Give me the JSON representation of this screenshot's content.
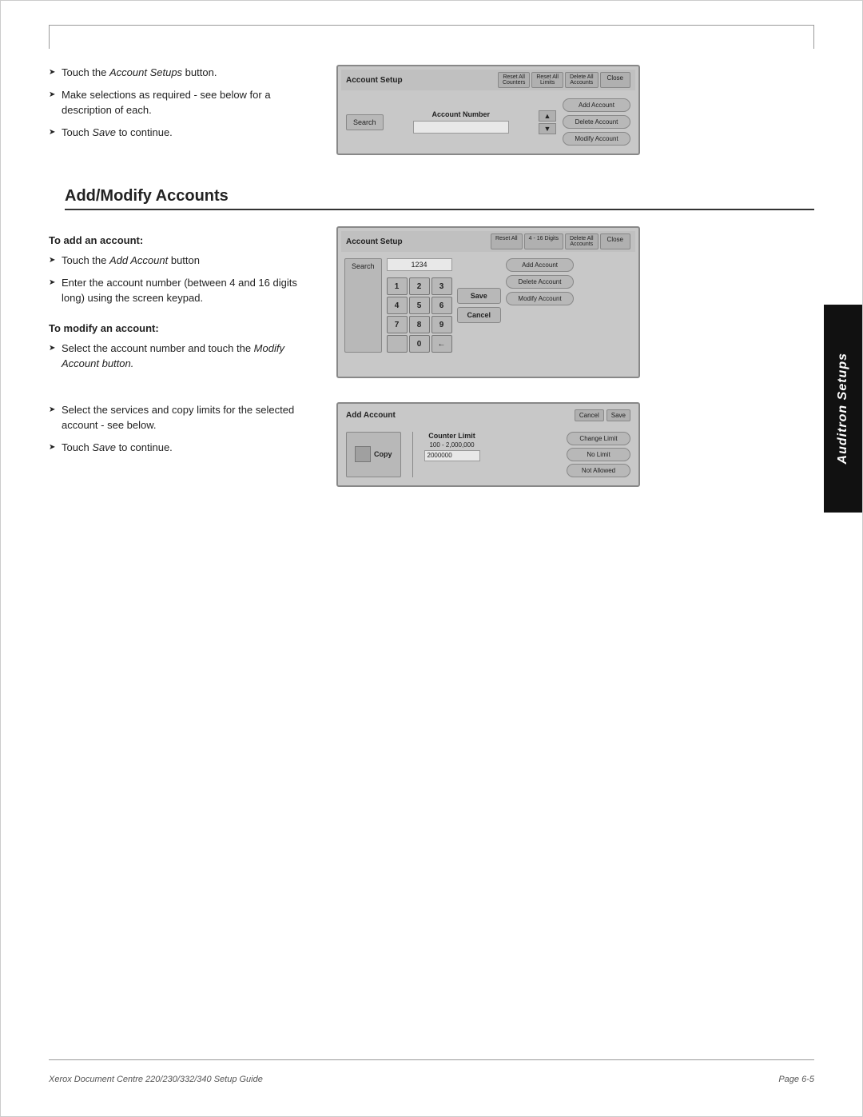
{
  "page": {
    "title": "Auditron Setups",
    "footer_left": "Xerox Document Centre 220/230/332/340 Setup Guide",
    "footer_right": "Page 6-5"
  },
  "section1": {
    "bullets": [
      "Touch the Account Setups button.",
      "Make selections as required - see below for a description of each.",
      "Touch Save to continue."
    ],
    "bullet_italic_parts": [
      "Account Setups",
      "Save"
    ]
  },
  "account_setup_ui1": {
    "title": "Account Setup",
    "btn_reset_all_counters": "Reset All Counters",
    "btn_reset_all_limits": "Reset All Limits",
    "btn_delete_all_accounts": "Delete All Accounts",
    "btn_close": "Close",
    "btn_search": "Search",
    "label_account_number": "Account Number",
    "btn_add_account": "Add Account",
    "btn_delete_account": "Delete Account",
    "btn_modify_account": "Modify Account"
  },
  "section_heading": "Add/Modify Accounts",
  "add_account_section": {
    "title": "To add an account:",
    "bullets": [
      "Touch the Add Account button",
      "Enter the account number (between 4 and 16 digits long) using the screen keypad.",
      ""
    ],
    "bullet_italic": [
      "Add Account",
      "Modify Account button."
    ]
  },
  "modify_section": {
    "title": "To modify an account:",
    "bullets": [
      "Select the account number and touch the Modify Account button."
    ]
  },
  "account_setup_ui2": {
    "title": "Account Setup",
    "btn_reset_all": "Reset All",
    "digits_label": "4 - 16 Digits",
    "btn_delete_all": "Delete All Accounts",
    "btn_close": "Close",
    "display_value": "1234",
    "keys": [
      "1",
      "2",
      "3",
      "4",
      "5",
      "6",
      "7",
      "8",
      "9",
      "",
      "0",
      "←"
    ],
    "btn_save": "Save",
    "btn_cancel": "Cancel",
    "btn_search": "Search",
    "btn_add_account": "Add Account",
    "btn_delete_account": "Delete Account",
    "btn_modify_account": "Modify Account"
  },
  "section3": {
    "bullets": [
      "Select the services and copy limits for the selected account - see below.",
      "Touch Save to continue."
    ],
    "bullet_italic": [
      "Save"
    ]
  },
  "add_account_ui": {
    "title": "Add Account",
    "btn_cancel": "Cancel",
    "btn_save": "Save",
    "btn_copy": "Copy",
    "counter_limit_label": "Counter Limit",
    "counter_limit_range": "100 - 2,000,000",
    "counter_limit_value": "2000000",
    "btn_change_limit": "Change Limit",
    "btn_no_limit": "No Limit",
    "btn_not_allowed": "Not Allowed"
  }
}
